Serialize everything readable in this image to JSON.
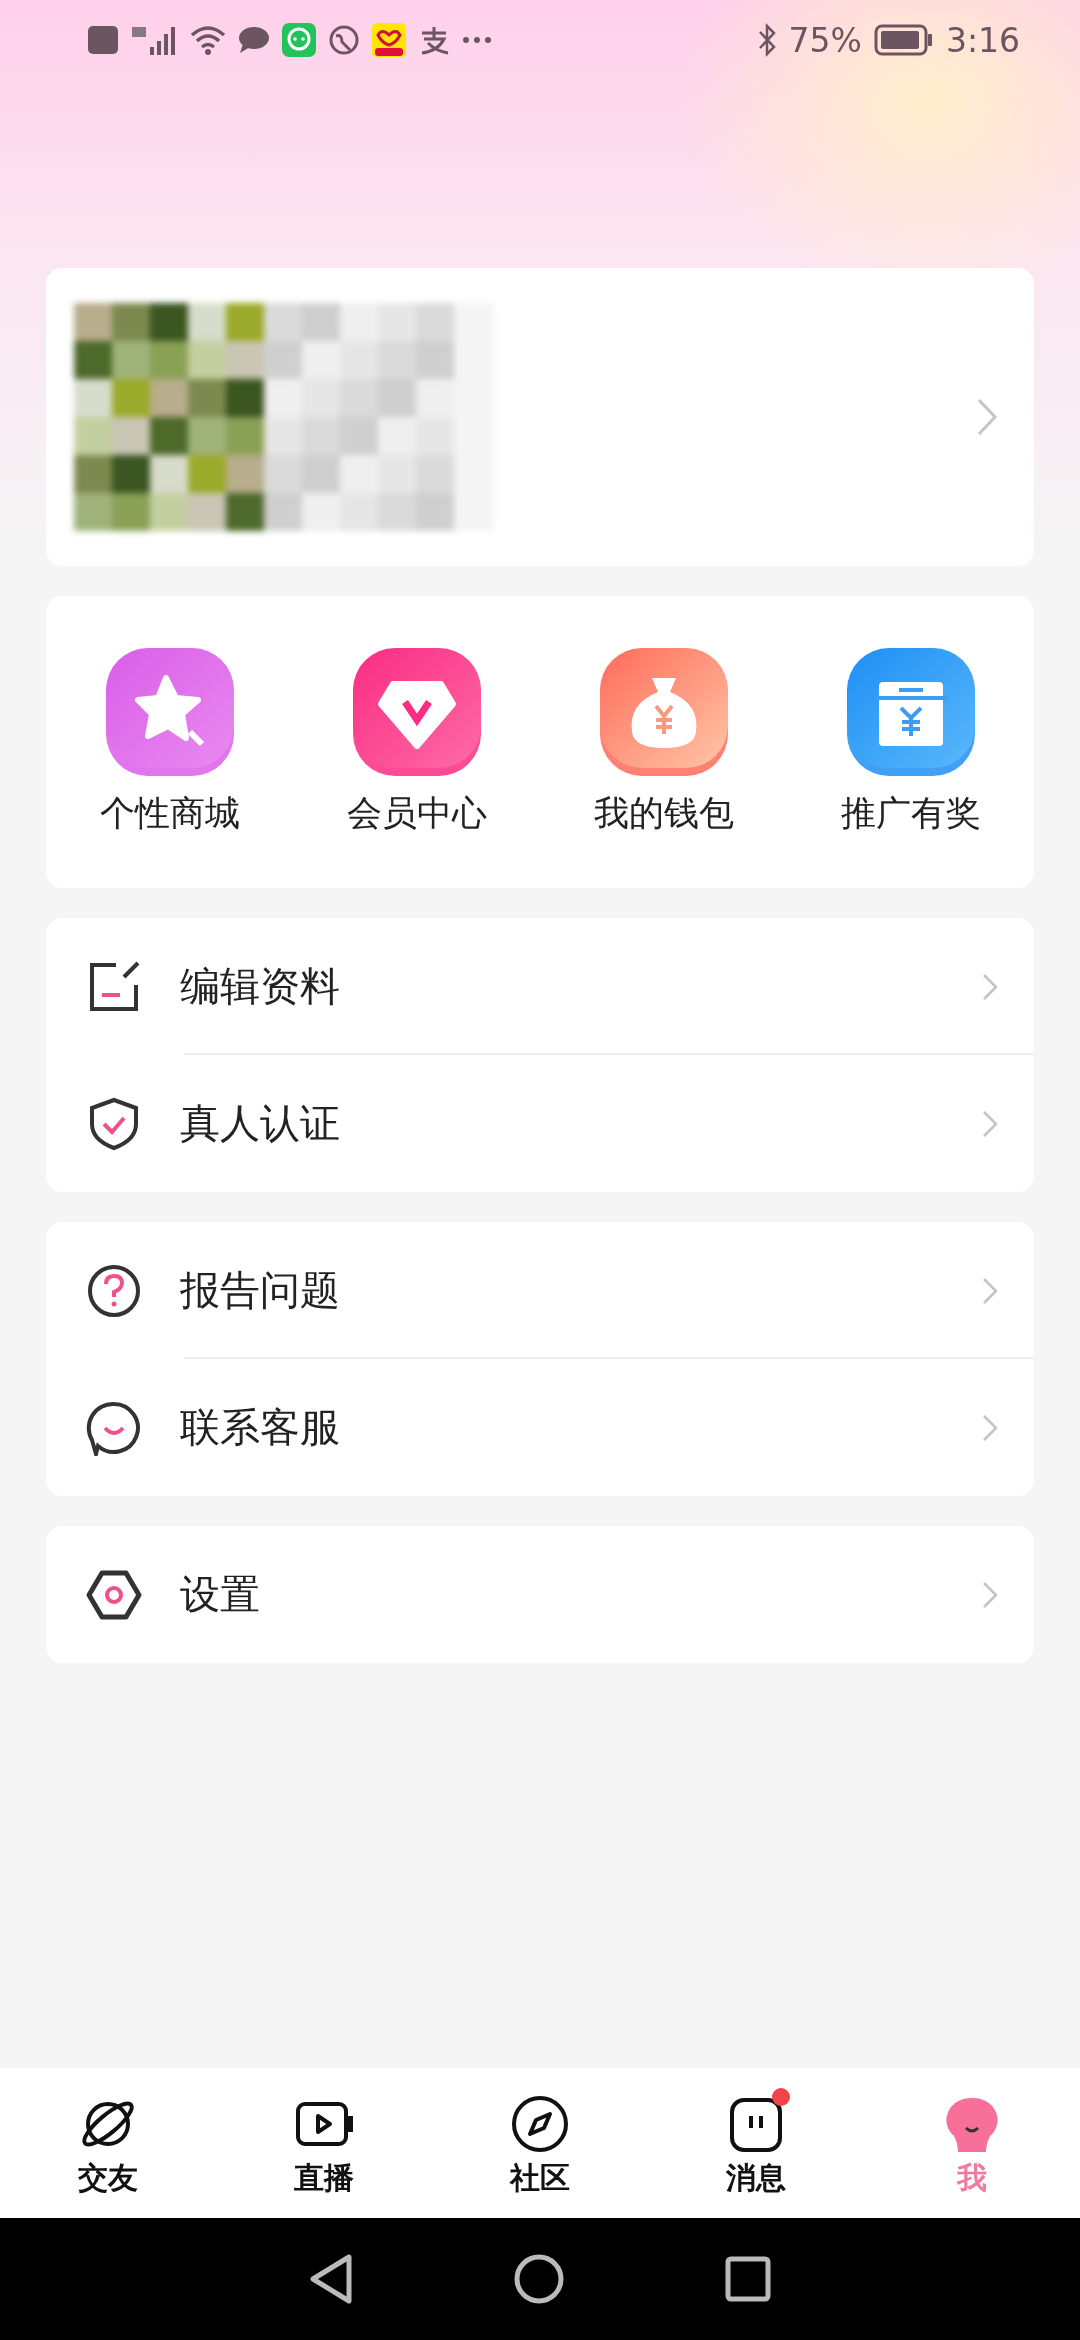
{
  "status_bar": {
    "battery": "75%",
    "time": "3:16"
  },
  "profile_card": {
    "kind": "picture"
  },
  "shortcuts": [
    {
      "label": "个性商城"
    },
    {
      "label": "会员中心"
    },
    {
      "label": "我的钱包"
    },
    {
      "label": "推广有奖"
    }
  ],
  "menu_groups": [
    [
      {
        "label": "编辑资料"
      },
      {
        "label": "真人认证"
      }
    ],
    [
      {
        "label": "报告问题"
      },
      {
        "label": "联系客服"
      }
    ],
    [
      {
        "label": "设置"
      }
    ]
  ],
  "tabs": [
    {
      "label": "交友",
      "selected": false,
      "dot": false
    },
    {
      "label": "直播",
      "selected": false,
      "dot": false
    },
    {
      "label": "社区",
      "selected": false,
      "dot": false
    },
    {
      "label": "消息",
      "selected": false,
      "dot": true
    },
    {
      "label": "我",
      "selected": true,
      "dot": false
    }
  ]
}
